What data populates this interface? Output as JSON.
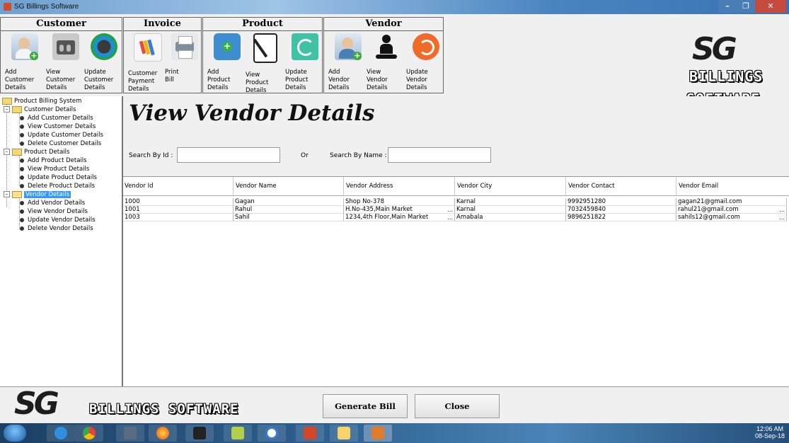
{
  "window": {
    "title": "SG Billings Software",
    "min": "–",
    "max": "❐",
    "close": "✕"
  },
  "ribbon": {
    "groups": [
      {
        "title": "Customer",
        "tools": [
          "Add\nCustomer\nDetails",
          "View\nCustomer\nDetails",
          "Update\nCustomer\nDetails"
        ]
      },
      {
        "title": "Invoice",
        "tools": [
          "Customer\nPayment\nDetails",
          "Print\nBill"
        ]
      },
      {
        "title": "Product",
        "tools": [
          "Add\nProduct\nDetails",
          "View\nProduct\nDetails",
          "Update\nProduct\nDetails"
        ]
      },
      {
        "title": "Vendor",
        "tools": [
          "Add\nVendor\nDetails",
          "View\nVendor\nDetails",
          "Update\nVendor\nDetails"
        ]
      }
    ]
  },
  "logo": {
    "mark": "SG",
    "line1": "BILLINGS",
    "line2": "SOFTWARE",
    "footer_word": "BILLINGS SOFTWARE"
  },
  "tree": {
    "root": "Product Billing System",
    "customer": {
      "label": "Customer Details",
      "items": [
        "Add Customer Details",
        "View Customer Details",
        "Update Customer Details",
        "Delete Customer Details"
      ]
    },
    "product": {
      "label": "Product Details",
      "items": [
        "Add Product Details",
        "View Product Details",
        "Update Product Details",
        "Delete Product Details"
      ]
    },
    "vendor": {
      "label": "Vendor Details",
      "items": [
        "Add Vendor Details",
        "View Vendor Details",
        "Update Vendor Details",
        "Delete Vendor Details"
      ]
    }
  },
  "main": {
    "title": "View Vendor Details",
    "search_by_id_label": "Search By Id :",
    "or_label": "Or",
    "search_by_name_label": "Search By Name :",
    "search_by_id_value": "",
    "search_by_name_value": ""
  },
  "table": {
    "columns": [
      "Vendor Id",
      "Vendor Name",
      "Vendor Address",
      "Vendor City",
      "Vendor Contact",
      "Vendor Email"
    ],
    "rows": [
      [
        "1000",
        "Gagan",
        "Shop No-378",
        "Karnal",
        "9992951280",
        "gagan21@gmail.com"
      ],
      [
        "1001",
        "Rahul",
        "H.No-435,Main Market",
        "Karnal",
        "7032459840",
        "rahul21@gmail.com"
      ],
      [
        "1003",
        "Sahil",
        "1234,4th Floor,Main Market",
        "Amabala",
        "9896251822",
        "sahils12@gmail.com"
      ]
    ],
    "ellipsis": "..."
  },
  "buttons": {
    "generate_bill": "Generate Bill",
    "close": "Close"
  },
  "taskbar": {
    "time": "12:06 AM",
    "date": "08-Sep-18"
  },
  "colors": {
    "selection": "#3399ff",
    "taskbar": "#2d5f8e",
    "close_button": "#c74a3f"
  }
}
